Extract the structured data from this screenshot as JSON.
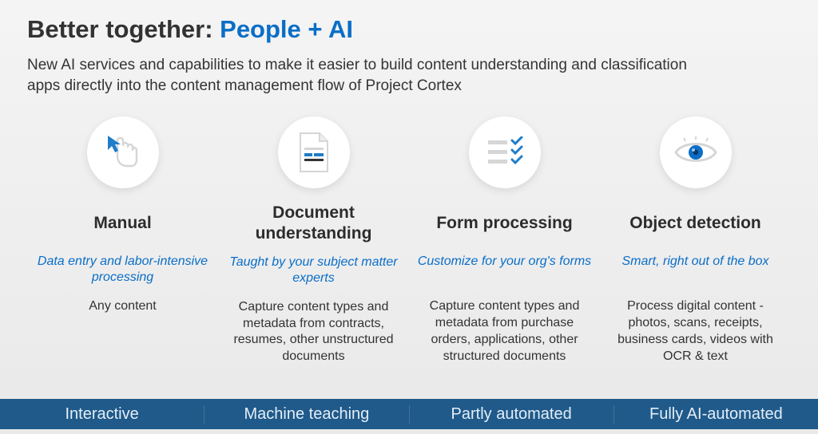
{
  "title_prefix": "Better together: ",
  "title_accent": "People + AI",
  "subtitle": "New AI services and capabilities to make it easier to build content understanding and classification apps directly into the content management flow of Project Cortex",
  "columns": [
    {
      "heading": "Manual",
      "tagline": "Data entry and labor-intensive processing",
      "body": "Any content"
    },
    {
      "heading": "Document understanding",
      "tagline": "Taught by your subject matter experts",
      "body": "Capture content types and metadata from contracts, resumes, other unstructured documents"
    },
    {
      "heading": "Form processing",
      "tagline": "Customize for your org's forms",
      "body": "Capture content types and metadata from purchase orders, applications, other structured documents"
    },
    {
      "heading": "Object detection",
      "tagline": "Smart, right out of the box",
      "body": "Process digital content - photos, scans, receipts, business cards, videos with OCR & text"
    }
  ],
  "footer": [
    "Interactive",
    "Machine teaching",
    "Partly automated",
    "Fully AI-automated"
  ]
}
